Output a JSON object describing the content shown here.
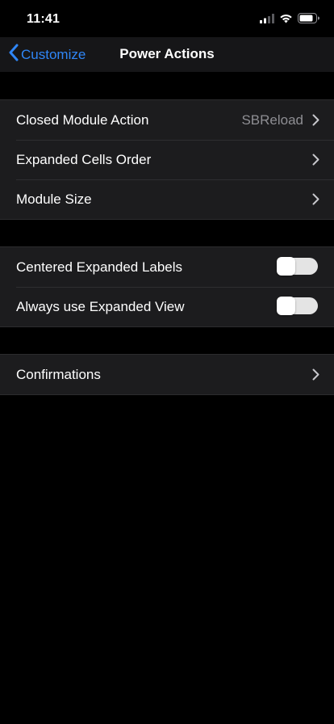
{
  "status_bar": {
    "time": "11:41",
    "icons": [
      "cellular-signal-icon",
      "wifi-icon",
      "battery-icon"
    ]
  },
  "nav": {
    "back_label": "Customize",
    "back_icon": "chevron-left-icon",
    "title": "Power Actions"
  },
  "sections": {
    "general": {
      "rows": [
        {
          "label": "Closed Module Action",
          "value": "SBReload"
        },
        {
          "label": "Expanded Cells Order"
        },
        {
          "label": "Module Size"
        }
      ]
    },
    "toggles": {
      "rows": [
        {
          "label": "Centered Expanded Labels",
          "on": false
        },
        {
          "label": "Always use Expanded View",
          "on": false
        }
      ]
    },
    "other": {
      "rows": [
        {
          "label": "Confirmations"
        }
      ]
    }
  },
  "colors": {
    "accent": "#2f86f7",
    "background": "#000000",
    "cell_background": "#1c1c1e",
    "secondary_text": "#8e8e93",
    "chevron": "#c7c7cc"
  }
}
